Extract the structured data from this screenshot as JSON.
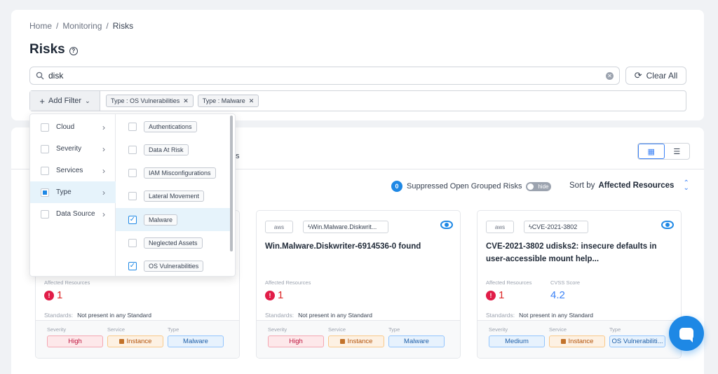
{
  "breadcrumb": {
    "home": "Home",
    "sep": "/",
    "monitoring": "Monitoring",
    "current": "Risks"
  },
  "page_title": "Risks",
  "search": {
    "value": "disk",
    "clear_all": "Clear All"
  },
  "filters": {
    "add_filter": "Add Filter",
    "chips": [
      "Type : OS Vulnerabilities",
      "Type : Malware"
    ]
  },
  "filter_menu": {
    "categories": [
      "Cloud",
      "Severity",
      "Services",
      "Type",
      "Data Source"
    ],
    "active_category": "Type",
    "type_options": [
      {
        "label": "Authentications",
        "checked": false
      },
      {
        "label": "Data At Risk",
        "checked": false
      },
      {
        "label": "IAM Misconfigurations",
        "checked": false
      },
      {
        "label": "Lateral Movement",
        "checked": false
      },
      {
        "label": "Malware",
        "checked": true
      },
      {
        "label": "Neglected Assets",
        "checked": false
      },
      {
        "label": "OS Vulnerabilities",
        "checked": true
      }
    ]
  },
  "tab_partial": "s",
  "suppressed": {
    "count": "0",
    "label": "Suppressed Open Grouped Risks",
    "toggle": "hide"
  },
  "sort": {
    "prefix": "Sort by",
    "value": "Affected Resources"
  },
  "labels": {
    "affected_resources": "Affected Resources",
    "cvss_score": "CVSS Score",
    "standards": "Standards:",
    "severity": "Severity",
    "service": "Service",
    "type": "Type",
    "aws": "aws"
  },
  "cards": [
    {
      "affected": "1",
      "standards": "Not present in any Standard",
      "severity": "High",
      "service": "Instance",
      "type": "Malware"
    },
    {
      "tag": "Win.Malware.Diskwrit...",
      "title": "Win.Malware.Diskwriter-6914536-0 found",
      "affected": "1",
      "standards": "Not present in any Standard",
      "severity": "High",
      "service": "Instance",
      "type": "Malware"
    },
    {
      "tag": "CVE-2021-3802",
      "title": "CVE-2021-3802 udisks2: insecure defaults in user-accessible mount help...",
      "affected": "1",
      "cvss": "4.2",
      "standards": "Not present in any Standard",
      "severity": "Medium",
      "service": "Instance",
      "type": "OS Vulnerabiliti..."
    }
  ],
  "colors": {
    "accent": "#1e88e5",
    "high": "#be123c",
    "instance": "#b45309"
  }
}
